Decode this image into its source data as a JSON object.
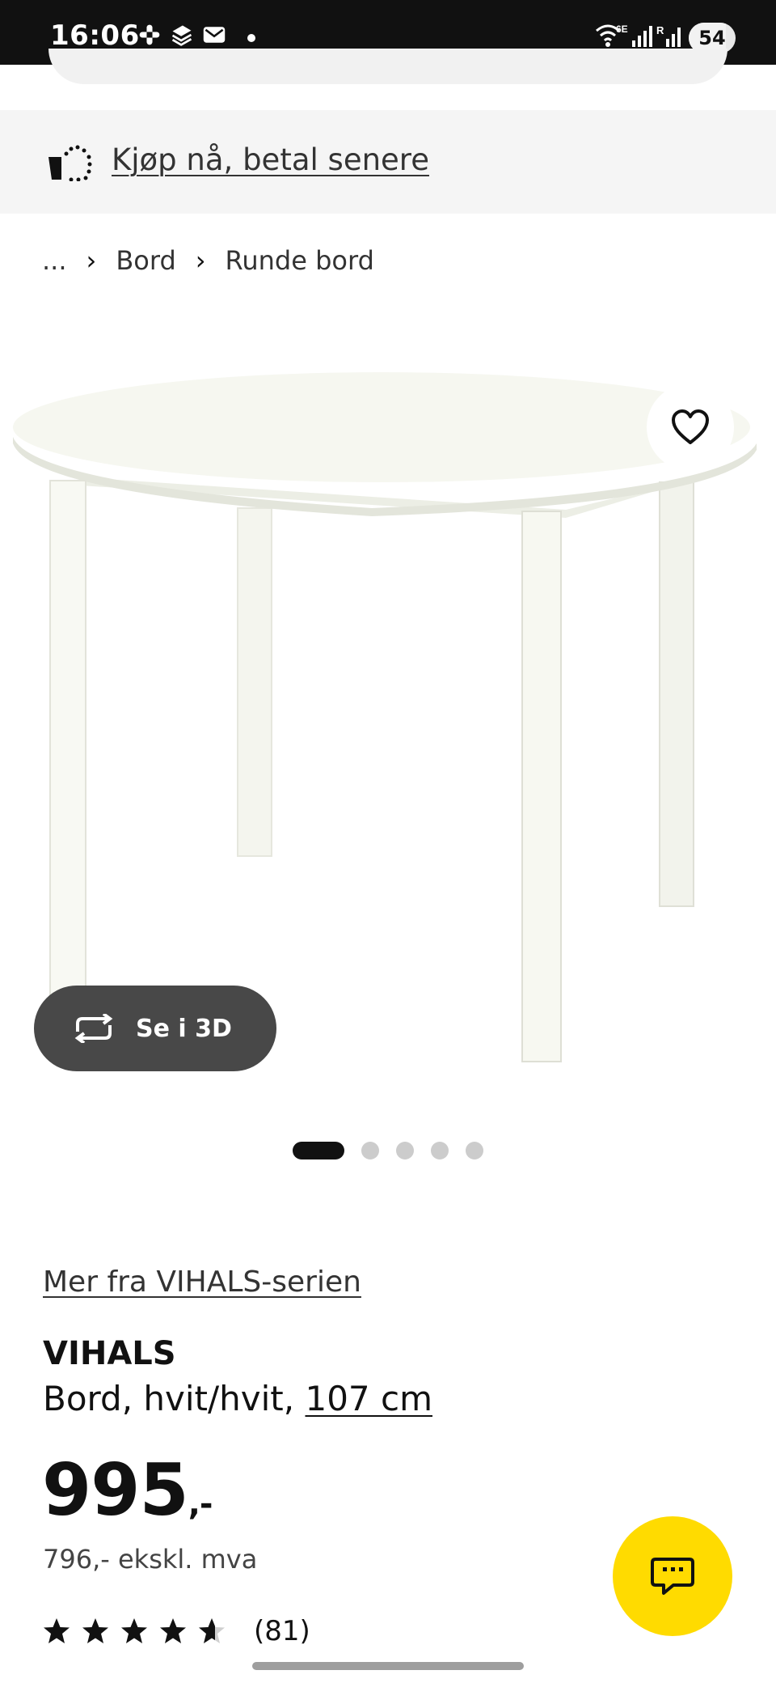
{
  "status_bar": {
    "time": "16:06",
    "notification_icons": [
      "slack-icon",
      "layers-app-icon",
      "mail-icon",
      "more-notifications-dot"
    ],
    "network_label": "6E",
    "battery_level": "54"
  },
  "banner": {
    "icon": "installment-payment-icon",
    "link_label": "Kjøp nå, betal senere"
  },
  "breadcrumb": {
    "items": [
      "...",
      "Bord",
      "Runde bord"
    ],
    "separator_icon": "chevron-right-icon"
  },
  "gallery": {
    "image_alt": "VIHALS round white table",
    "favourite_icon": "heart-outline-icon",
    "view_3d_label": "Se i 3D",
    "view_3d_icon": "rotate-arrows-icon",
    "total_images": 5,
    "active_image_index": 1
  },
  "product": {
    "series_link": "Mer fra VIHALS-serien",
    "name": "VIHALS",
    "description_prefix": "Bord, hvit/hvit, ",
    "size_link": "107 cm",
    "price_main": "995",
    "price_suffix": ",-",
    "price_ex_vat": "796,- ekskl. mva",
    "rating_value": 4.6,
    "rating_max": 5,
    "rating_count": "(81)"
  },
  "chat": {
    "icon": "chat-bubble-icon"
  },
  "colors": {
    "accent_yellow": "#ffdb00",
    "status_bar": "#111111",
    "banner_bg": "#f5f5f5",
    "view3d_bg": "#484848"
  }
}
